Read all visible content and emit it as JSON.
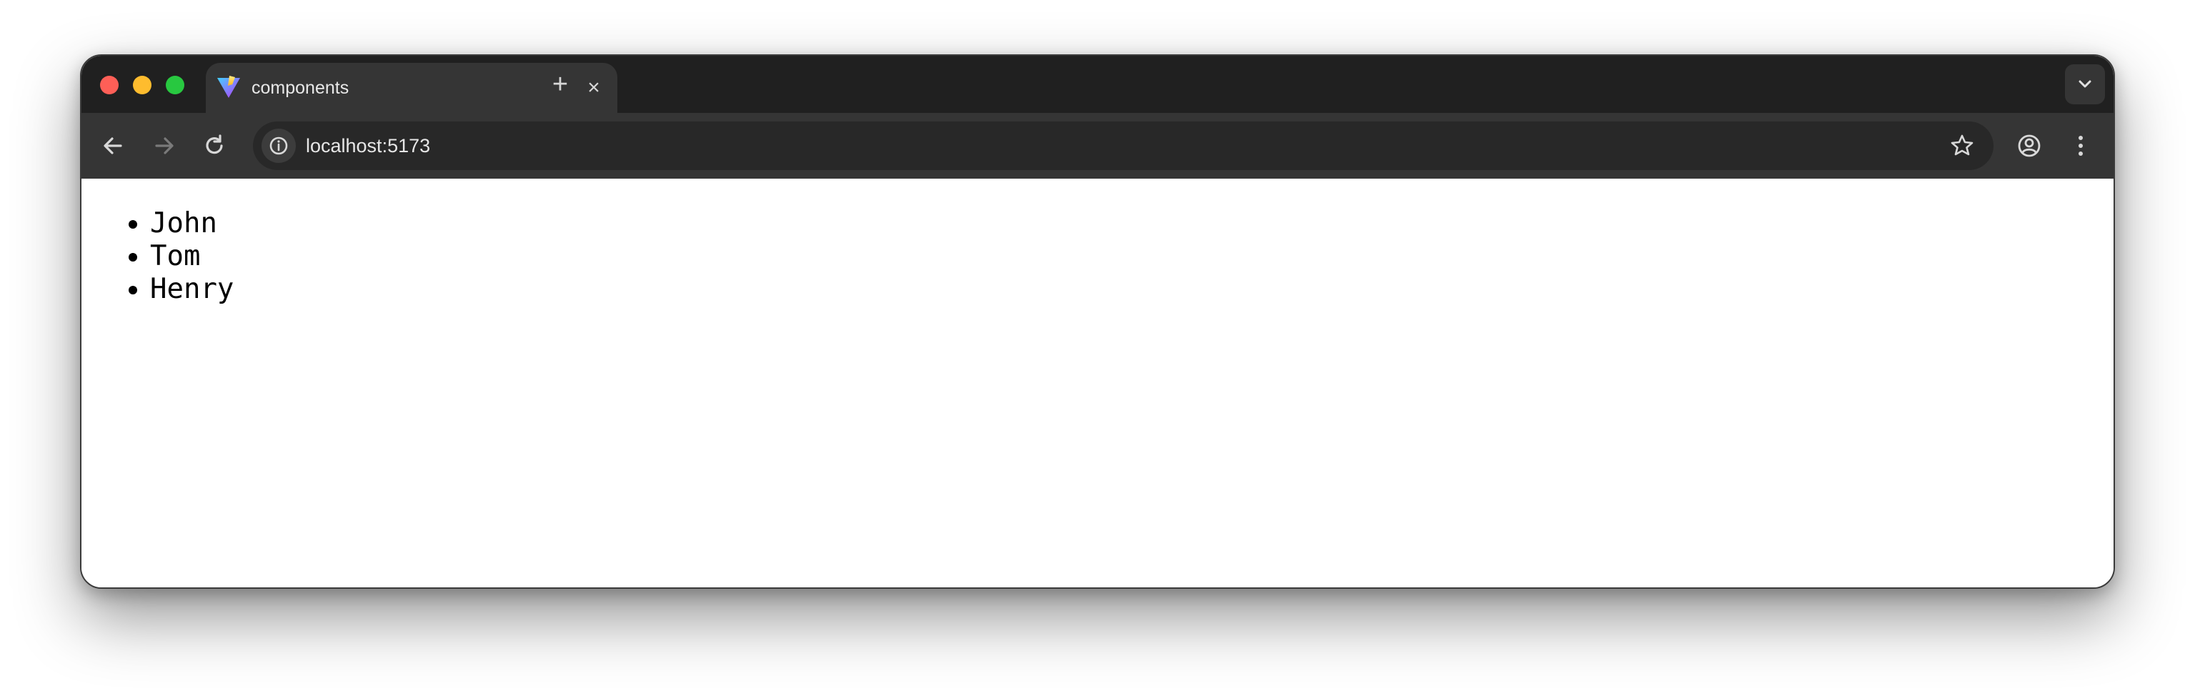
{
  "browser": {
    "tab": {
      "title": "components",
      "favicon": "vite-logo-icon"
    },
    "address_bar": {
      "url": "localhost:5173"
    },
    "colors": {
      "close": "#fe5f57",
      "minimize": "#febc2e",
      "maximize": "#28c840",
      "tabstrip": "#202020",
      "toolbar": "#353535"
    }
  },
  "page": {
    "names": [
      "John",
      "Tom",
      "Henry"
    ]
  }
}
